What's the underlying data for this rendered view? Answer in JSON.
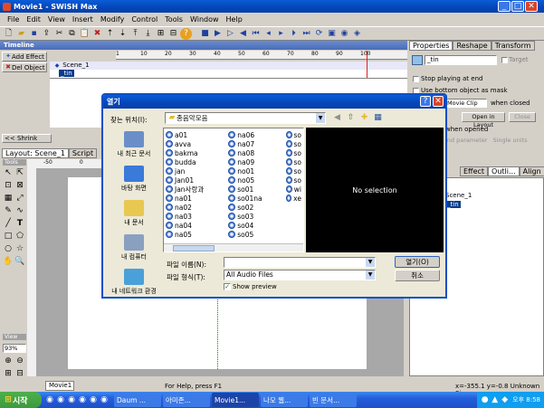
{
  "window": {
    "title": "Movie1 - SWiSH Max"
  },
  "menu": [
    "File",
    "Edit",
    "View",
    "Insert",
    "Modify",
    "Control",
    "Tools",
    "Window",
    "Help"
  ],
  "timeline": {
    "label": "Timeline",
    "add_effect": "Add Effect",
    "del_object": "Del Object",
    "scene_row": "Scene_1",
    "object_row": "_tin",
    "ruler": [
      "1",
      "10",
      "20",
      "30",
      "40",
      "50",
      "60",
      "70",
      "80",
      "90",
      "100",
      "110"
    ]
  },
  "properties": {
    "tabs": [
      "Properties",
      "Reshape",
      "Transform"
    ],
    "name_value": "_tin",
    "target_label": "Target",
    "stop_playing": "Stop playing at end",
    "use_bottom": "Use bottom object as mask",
    "movie_clip_option": "Movie Clip",
    "when_closed": "when closed",
    "open_layout": "Open in Layout",
    "close_btn": "Close",
    "when_opened": "when opened",
    "ind_param": "ind parameter",
    "single_units": "Single units"
  },
  "outline": {
    "tabs": [
      "Effect",
      "Outli...",
      "Align"
    ],
    "scene": "Scene_1",
    "item": "_tin"
  },
  "left": {
    "shrink": "<< Shrink",
    "tabs": [
      "Layout: Scene_1",
      "Script"
    ],
    "tools_label": "Tools",
    "view_label": "View",
    "zoom": "93%",
    "ruler_top": [
      "-50",
      "0",
      "50"
    ],
    "doc_tab": "Movie1"
  },
  "dialog": {
    "title": "열기",
    "look_in_label": "찾는 위치(I):",
    "look_in_value": "종음악모음",
    "places": [
      {
        "label": "내 최근 문서",
        "color": "#6a8fc8"
      },
      {
        "label": "바탕 화면",
        "color": "#3a7ad8"
      },
      {
        "label": "내 문서",
        "color": "#e8c850"
      },
      {
        "label": "내 컴퓨터",
        "color": "#8aa0c0"
      },
      {
        "label": "내 네트워크 환경",
        "color": "#4aa0d8"
      }
    ],
    "col1": [
      "a01",
      "avva",
      "bakma",
      "budda",
      "jan",
      "Jan01",
      "Jan사랑과",
      "na01",
      "na02",
      "na03",
      "na04",
      "na05"
    ],
    "col2": [
      "na06",
      "na07",
      "na08",
      "na09",
      "no01",
      "no05",
      "so01",
      "so01na",
      "so02",
      "so03",
      "so04",
      "so05"
    ],
    "col3": [
      "so",
      "so",
      "so",
      "so",
      "so",
      "so",
      "wi",
      "xe"
    ],
    "preview": "No selection",
    "filename_label": "파일 이름(N):",
    "filename_value": "",
    "filetype_label": "파일 형식(T):",
    "filetype_value": "All Audio Files",
    "show_preview": "Show preview",
    "open_btn": "열기(O)",
    "cancel_btn": "취소"
  },
  "status": {
    "help": "For Help, press F1",
    "coords": "x=-355.1 y=-0.8 Unknown Size"
  },
  "taskbar": {
    "start": "시작",
    "items": [
      "Daum ...",
      "아미존...",
      "Movie1...",
      "나모 웹...",
      "빈 문서..."
    ],
    "clock": "오후 8:58"
  },
  "colors": {
    "title_blue": "#0a50c8",
    "taskbar": "#245edb",
    "start_green": "#3c9a3c",
    "close_red": "#d8452a"
  }
}
